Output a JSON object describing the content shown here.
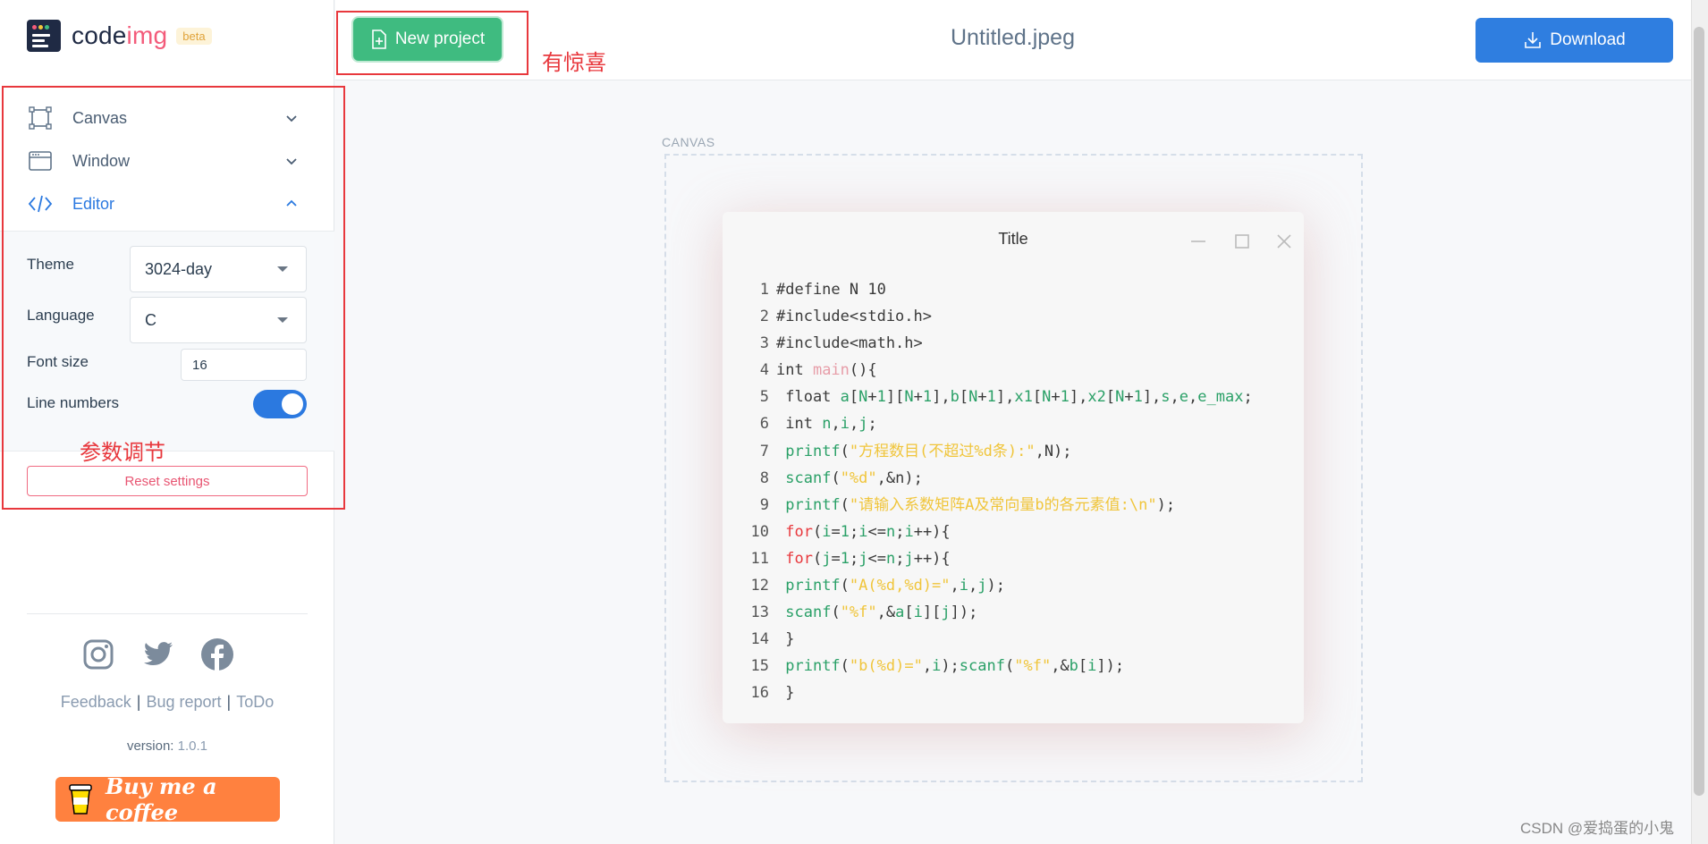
{
  "app": {
    "logo_text_prefix": "code",
    "logo_text_accent": "img",
    "beta_badge": "beta"
  },
  "sidebar": {
    "nav": [
      {
        "label": "Canvas",
        "icon": "canvas-icon"
      },
      {
        "label": "Window",
        "icon": "window-icon"
      },
      {
        "label": "Editor",
        "icon": "code-icon"
      }
    ],
    "editor": {
      "theme_label": "Theme",
      "theme_value": "3024-day",
      "language_label": "Language",
      "language_value": "C",
      "font_size_label": "Font size",
      "font_size_value": "16",
      "line_numbers_label": "Line numbers",
      "line_numbers_on": true,
      "reset_label": "Reset settings"
    },
    "footer": {
      "feedback": "Feedback",
      "bug_report": "Bug report",
      "todo": "ToDo",
      "version_label": "version:",
      "version_value": "1.0.1",
      "coffee_label": "Buy me a coffee"
    }
  },
  "annotations": {
    "surprise": "有惊喜",
    "params": "参数调节"
  },
  "toolbar": {
    "new_project_label": "New project",
    "file_name": "Untitled.jpeg",
    "download_label": "Download"
  },
  "canvas": {
    "label": "CANVAS",
    "window_title": "Title"
  },
  "watermark": "CSDN @爱捣蛋的小鬼",
  "colors": {
    "accent_blue": "#2f7ee0",
    "new_project_green": "#3fbb80",
    "annotation_red": "#e8383d",
    "coffee_orange": "#ff813f"
  }
}
